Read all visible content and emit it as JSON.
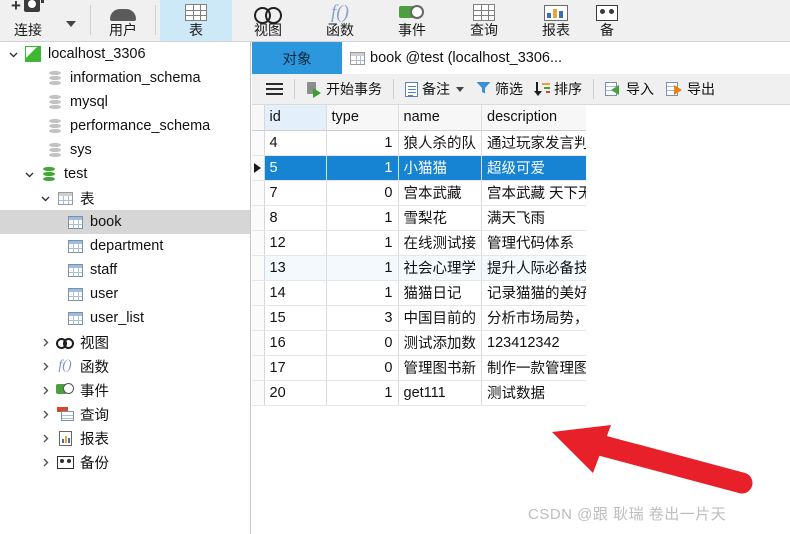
{
  "ribbon": {
    "items": [
      {
        "label": "连接",
        "icon": "new-connection-icon",
        "selected": false
      },
      {
        "label": "用户",
        "icon": "user-icon",
        "selected": false
      },
      {
        "label": "表",
        "icon": "table-icon",
        "selected": true
      },
      {
        "label": "视图",
        "icon": "view-icon",
        "selected": false
      },
      {
        "label": "函数",
        "icon": "function-icon",
        "selected": false
      },
      {
        "label": "事件",
        "icon": "event-icon",
        "selected": false
      },
      {
        "label": "查询",
        "icon": "query-icon",
        "selected": false
      },
      {
        "label": "报表",
        "icon": "report-icon",
        "selected": false
      },
      {
        "label": "备",
        "icon": "backup-icon",
        "selected": false
      }
    ]
  },
  "sidebar": {
    "nodes": [
      {
        "label": "localhost_3306",
        "icon": "navicat-flag-icon",
        "indent": 0,
        "expander": "expanded",
        "selected": false
      },
      {
        "label": "information_schema",
        "icon": "database-grey-icon",
        "indent": 1,
        "expander": "none",
        "selected": false
      },
      {
        "label": "mysql",
        "icon": "database-grey-icon",
        "indent": 1,
        "expander": "none",
        "selected": false
      },
      {
        "label": "performance_schema",
        "icon": "database-grey-icon",
        "indent": 1,
        "expander": "none",
        "selected": false
      },
      {
        "label": "sys",
        "icon": "database-grey-icon",
        "indent": 1,
        "expander": "none",
        "selected": false
      },
      {
        "label": "test",
        "icon": "database-green-icon",
        "indent": 1,
        "expander": "expanded",
        "selected": false
      },
      {
        "label": "表",
        "icon": "table-folder-icon",
        "indent": 2,
        "expander": "expanded",
        "selected": false
      },
      {
        "label": "book",
        "icon": "table-icon",
        "indent": 3,
        "expander": "none",
        "selected": true
      },
      {
        "label": "department",
        "icon": "table-icon",
        "indent": 3,
        "expander": "none",
        "selected": false
      },
      {
        "label": "staff",
        "icon": "table-icon",
        "indent": 3,
        "expander": "none",
        "selected": false
      },
      {
        "label": "user",
        "icon": "table-icon",
        "indent": 3,
        "expander": "none",
        "selected": false
      },
      {
        "label": "user_list",
        "icon": "table-icon",
        "indent": 3,
        "expander": "none",
        "selected": false
      },
      {
        "label": "视图",
        "icon": "view-icon",
        "indent": 2,
        "expander": "collapsed",
        "selected": false
      },
      {
        "label": "函数",
        "icon": "function-icon",
        "indent": 2,
        "expander": "collapsed",
        "selected": false
      },
      {
        "label": "事件",
        "icon": "event-icon",
        "indent": 2,
        "expander": "collapsed",
        "selected": false
      },
      {
        "label": "查询",
        "icon": "query-icon",
        "indent": 2,
        "expander": "collapsed",
        "selected": false
      },
      {
        "label": "报表",
        "icon": "report-icon",
        "indent": 2,
        "expander": "collapsed",
        "selected": false
      },
      {
        "label": "备份",
        "icon": "backup-icon",
        "indent": 2,
        "expander": "collapsed",
        "selected": false
      }
    ]
  },
  "tabs": {
    "object_tab": "对象",
    "doc_tab": "book @test (localhost_3306..."
  },
  "grid_toolbar": {
    "menu_icon": "hamburger-icon",
    "begin_transaction": "开始事务",
    "note": "备注",
    "filter": "筛选",
    "sort": "排序",
    "import": "导入",
    "export": "导出"
  },
  "table": {
    "columns": [
      "id",
      "type",
      "name",
      "description"
    ],
    "active_column": "id",
    "rows": [
      {
        "id": "4",
        "type": "1",
        "name": "狼人杀的队",
        "description": "通过玩家发言判断",
        "state": "normal"
      },
      {
        "id": "5",
        "type": "1",
        "name": "小猫猫",
        "description": "超级可爱",
        "state": "selected"
      },
      {
        "id": "7",
        "type": "0",
        "name": "宫本武藏",
        "description": "宫本武藏 天下无双",
        "state": "normal"
      },
      {
        "id": "8",
        "type": "1",
        "name": "雪梨花",
        "description": "满天飞雨",
        "state": "normal"
      },
      {
        "id": "12",
        "type": "1",
        "name": "在线测试接",
        "description": "管理代码体系",
        "state": "normal"
      },
      {
        "id": "13",
        "type": "1",
        "name": "社会心理学",
        "description": "提升人际必备技巧",
        "state": "hover"
      },
      {
        "id": "14",
        "type": "1",
        "name": "猫猫日记",
        "description": "记录猫猫的美好时",
        "state": "normal"
      },
      {
        "id": "15",
        "type": "3",
        "name": "中国目前的",
        "description": "分析市场局势，做",
        "state": "normal"
      },
      {
        "id": "16",
        "type": "0",
        "name": "测试添加数",
        "description": "123412342",
        "state": "normal"
      },
      {
        "id": "17",
        "type": "0",
        "name": "管理图书新",
        "description": "制作一款管理图书",
        "state": "normal"
      },
      {
        "id": "20",
        "type": "1",
        "name": "get111",
        "description": "测试数据",
        "state": "normal"
      }
    ]
  },
  "annotation": {
    "arrow_color": "#e8202a",
    "watermark": "CSDN @跟 耿瑞 卷出一片天"
  }
}
